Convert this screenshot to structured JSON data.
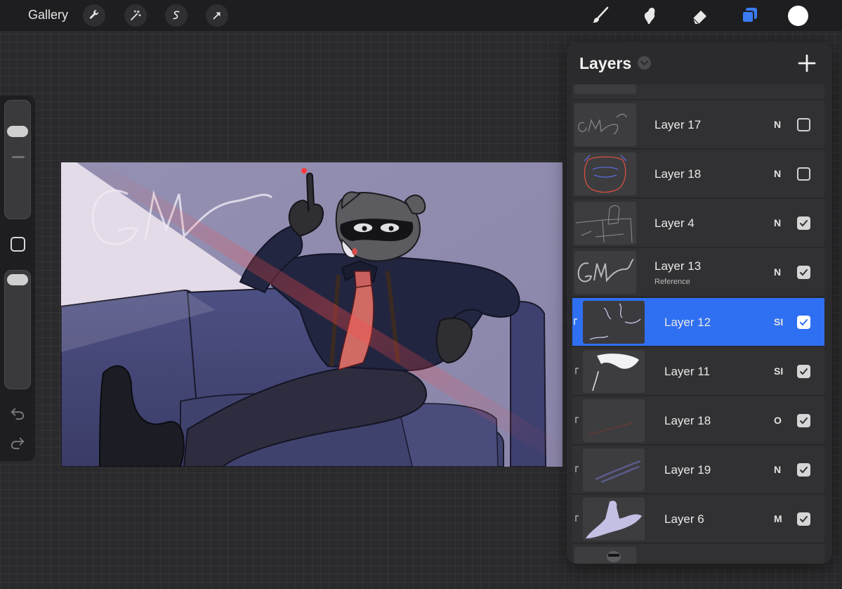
{
  "topbar": {
    "gallery_label": "Gallery",
    "left_tools": [
      "wrench-icon",
      "magic-wand-icon",
      "selection-icon",
      "transform-arrow-icon"
    ],
    "right_tools": [
      "brush-icon",
      "smudge-icon",
      "eraser-icon",
      "layers-icon"
    ],
    "layers_active_color": "#3a7bf2",
    "current_color": "#ffffff"
  },
  "sidebar": {
    "brush_size_level": 0.75,
    "opacity_level": 0.9,
    "icons": [
      "modify-square-icon",
      "undo-icon",
      "redo-icon"
    ]
  },
  "layers_panel": {
    "title": "Layers",
    "add_icon": "plus-icon",
    "accent_color": "#2f6ff2",
    "layers": [
      {
        "name": "Layer 17",
        "sub": "",
        "mode": "N",
        "visible": false,
        "selected": false,
        "clipped": false
      },
      {
        "name": "Layer 18",
        "sub": "",
        "mode": "N",
        "visible": false,
        "selected": false,
        "clipped": false
      },
      {
        "name": "Layer 4",
        "sub": "",
        "mode": "N",
        "visible": true,
        "selected": false,
        "clipped": false
      },
      {
        "name": "Layer 13",
        "sub": "Reference",
        "mode": "N",
        "visible": true,
        "selected": false,
        "clipped": false
      },
      {
        "name": "Layer 12",
        "sub": "",
        "mode": "SI",
        "visible": true,
        "selected": true,
        "clipped": true
      },
      {
        "name": "Layer 11",
        "sub": "",
        "mode": "SI",
        "visible": true,
        "selected": false,
        "clipped": true
      },
      {
        "name": "Layer 18",
        "sub": "",
        "mode": "O",
        "visible": true,
        "selected": false,
        "clipped": true
      },
      {
        "name": "Layer 19",
        "sub": "",
        "mode": "N",
        "visible": true,
        "selected": false,
        "clipped": true
      },
      {
        "name": "Layer 6",
        "sub": "",
        "mode": "M",
        "visible": true,
        "selected": false,
        "clipped": true
      }
    ]
  }
}
